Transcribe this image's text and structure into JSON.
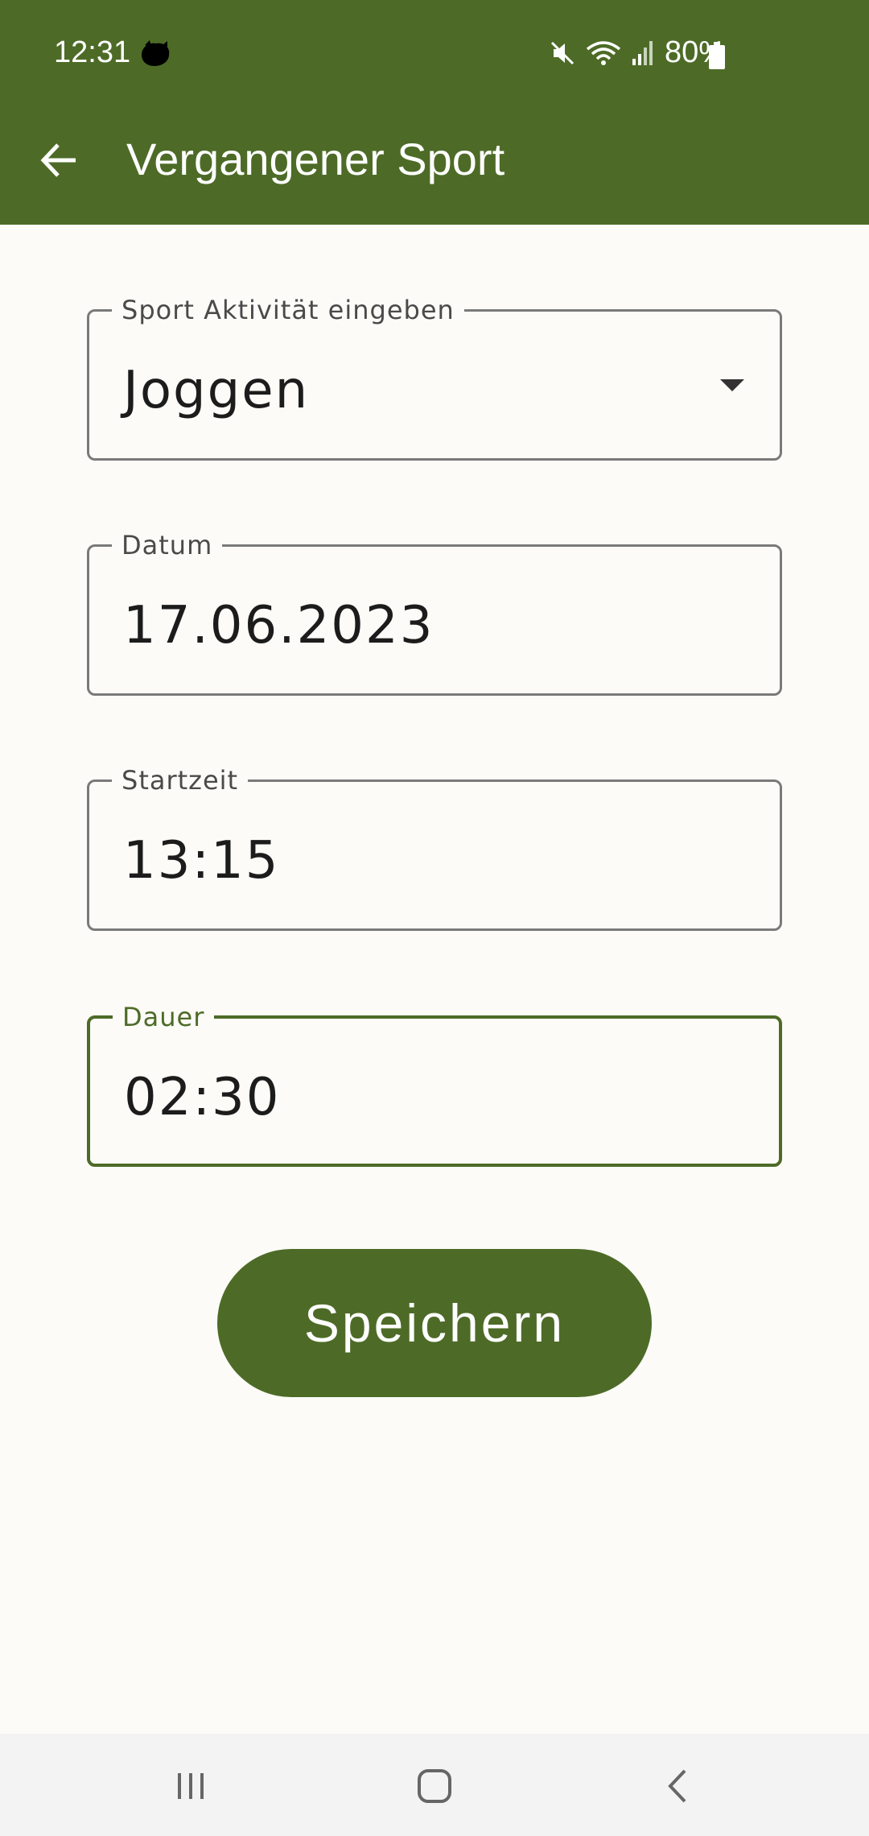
{
  "status": {
    "time": "12:31",
    "battery_percent": "80%"
  },
  "appbar": {
    "title": "Vergangener Sport"
  },
  "form": {
    "activity": {
      "label": "Sport Aktivität eingeben",
      "value": "Joggen"
    },
    "date": {
      "label": "Datum",
      "value": "17.06.2023"
    },
    "start_time": {
      "label": "Startzeit",
      "value": "13:15"
    },
    "duration": {
      "label": "Dauer",
      "value": "02:30"
    }
  },
  "actions": {
    "save_label": "Speichern"
  },
  "colors": {
    "primary": "#4d6b27",
    "background": "#fcfbf7",
    "border": "#7a7a7a"
  },
  "icons": {
    "back": "arrow-left-icon",
    "dropdown": "caret-down-icon",
    "mute": "mute-icon",
    "wifi": "wifi-icon",
    "signal": "signal-icon",
    "battery": "battery-icon",
    "recents": "recents-icon",
    "home": "home-icon",
    "nav_back": "chevron-left-icon"
  }
}
